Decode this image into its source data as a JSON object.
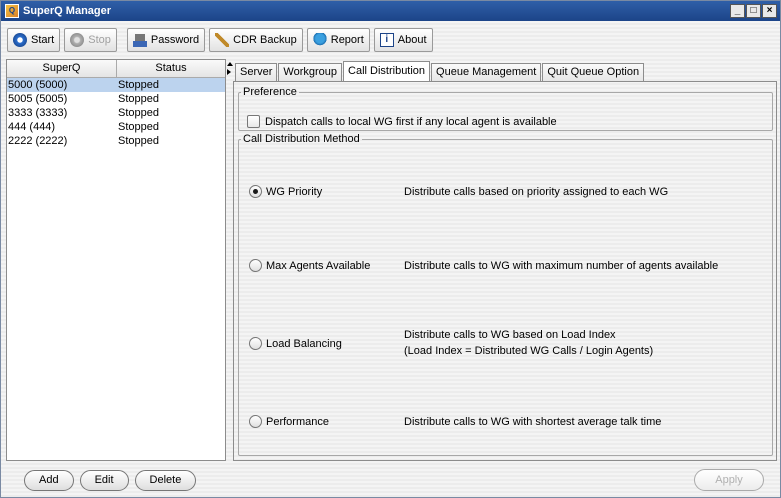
{
  "window": {
    "title": "SuperQ Manager"
  },
  "toolbar": {
    "start": "Start",
    "stop": "Stop",
    "password": "Password",
    "cdr_backup": "CDR Backup",
    "report": "Report",
    "about": "About"
  },
  "superq_table": {
    "headers": [
      "SuperQ",
      "Status"
    ],
    "rows": [
      {
        "superq": "5000 (5000)",
        "status": "Stopped"
      },
      {
        "superq": "5005 (5005)",
        "status": "Stopped"
      },
      {
        "superq": "3333 (3333)",
        "status": "Stopped"
      },
      {
        "superq": "444 (444)",
        "status": "Stopped"
      },
      {
        "superq": "2222 (2222)",
        "status": "Stopped"
      }
    ],
    "selected_index": 0
  },
  "left_actions": {
    "add": "Add",
    "edit": "Edit",
    "delete": "Delete"
  },
  "tabs": [
    "Server",
    "Workgroup",
    "Call Distribution",
    "Queue Management",
    "Quit Queue Option"
  ],
  "active_tab": "Call Distribution",
  "preference": {
    "legend": "Preference",
    "dispatch_label": "Dispatch calls to local WG first if any local agent is available",
    "dispatch_checked": false
  },
  "method": {
    "legend": "Call Distribution Method",
    "options": [
      {
        "label": "WG Priority",
        "desc1": "Distribute calls based on priority assigned to each WG",
        "desc2": "",
        "selected": true
      },
      {
        "label": "Max Agents Available",
        "desc1": "Distribute calls to WG with maximum number of agents available",
        "desc2": "",
        "selected": false
      },
      {
        "label": "Load Balancing",
        "desc1": "Distribute calls to WG based on Load Index",
        "desc2": "(Load Index = Distributed WG Calls / Login Agents)",
        "selected": false
      },
      {
        "label": "Performance",
        "desc1": "Distribute calls to WG with shortest average talk time",
        "desc2": "",
        "selected": false
      }
    ]
  },
  "apply": "Apply"
}
